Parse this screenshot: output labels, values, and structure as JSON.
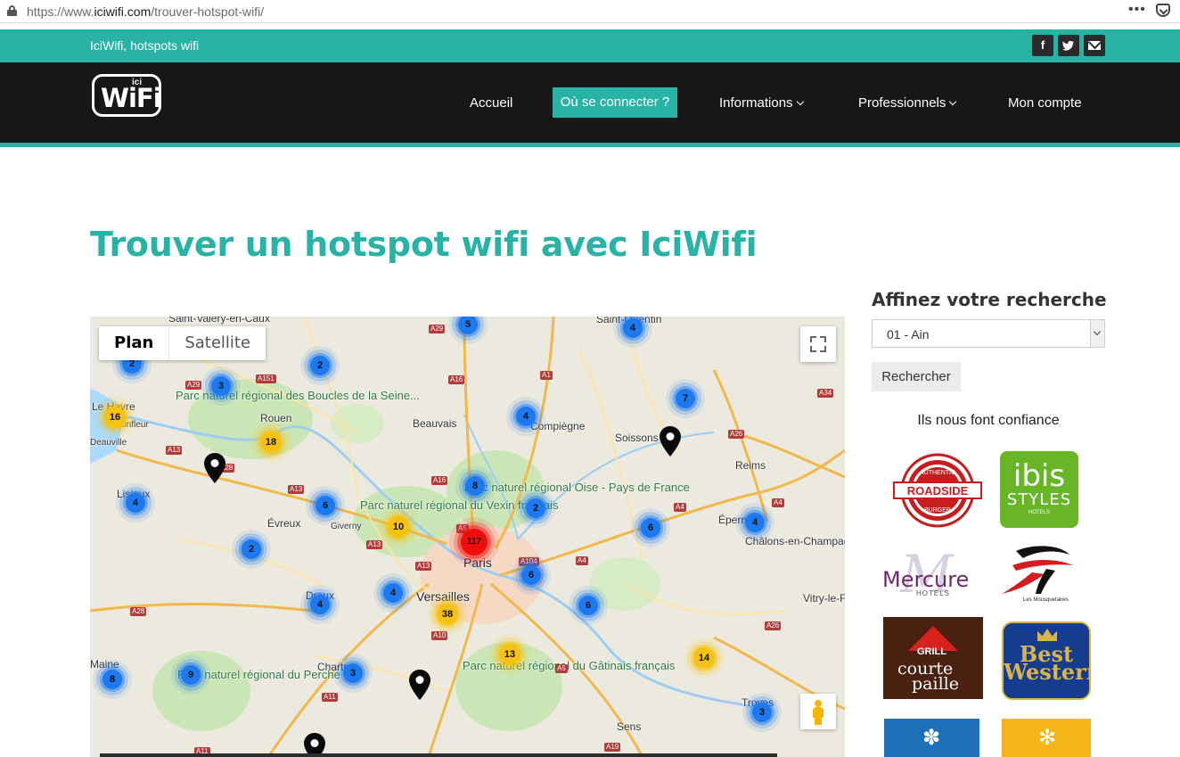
{
  "browser": {
    "url_prefix": "https://www.",
    "url_domain": "iciwifi.com",
    "url_path": "/trouver-hotspot-wifi/",
    "menu_glyph": "•••"
  },
  "topbar": {
    "tagline": "IciWifi, hotspots wifi",
    "social": [
      "f",
      "t",
      "mail"
    ]
  },
  "logo": {
    "text": "WiFi",
    "small": "ici"
  },
  "nav": {
    "home": "Accueil",
    "where": "Où se connecter ?",
    "info": "Informations",
    "pros": "Professionnels",
    "account": "Mon compte"
  },
  "page_title": "Trouver un hotspot wifi avec IciWifi",
  "map": {
    "type_plan": "Plan",
    "type_satellite": "Satellite",
    "clusters": [
      {
        "label": "2",
        "color": "blue"
      },
      {
        "label": "3",
        "color": "blue"
      },
      {
        "label": "16",
        "color": "yellow"
      },
      {
        "label": "2",
        "color": "blue"
      },
      {
        "label": "18",
        "color": "yellow"
      },
      {
        "label": "5",
        "color": "blue"
      },
      {
        "label": "4",
        "color": "blue"
      },
      {
        "label": "4",
        "color": "blue"
      },
      {
        "label": "7",
        "color": "blue"
      },
      {
        "label": "8",
        "color": "blue"
      },
      {
        "label": "2",
        "color": "blue"
      },
      {
        "label": "4",
        "color": "blue"
      },
      {
        "label": "6",
        "color": "blue"
      },
      {
        "label": "10",
        "color": "yellow"
      },
      {
        "label": "117",
        "color": "red"
      },
      {
        "label": "2",
        "color": "blue"
      },
      {
        "label": "6",
        "color": "blue"
      },
      {
        "label": "4",
        "color": "blue"
      },
      {
        "label": "6",
        "color": "blue"
      },
      {
        "label": "4",
        "color": "blue"
      },
      {
        "label": "4",
        "color": "blue"
      },
      {
        "label": "38",
        "color": "yellow"
      },
      {
        "label": "6",
        "color": "blue"
      },
      {
        "label": "13",
        "color": "yellow"
      },
      {
        "label": "14",
        "color": "yellow"
      },
      {
        "label": "9",
        "color": "blue"
      },
      {
        "label": "8",
        "color": "blue"
      },
      {
        "label": "3",
        "color": "blue"
      },
      {
        "label": "3",
        "color": "blue"
      }
    ],
    "places": [
      "Saint-Valery-en-Caux",
      "Saint-Quentin",
      "Le Havre",
      "Honfleur",
      "Deauville",
      "Rouen",
      "Beauvais",
      "Compiègne",
      "Soissons",
      "Reims",
      "Lisieux",
      "Évreux",
      "Giverny",
      "Paris",
      "Versailles",
      "Dreux",
      "Chartres",
      "Sens",
      "Troyes",
      "Épernay",
      "Châlons-en-Champagne",
      "Vitry-le-F",
      "Maine"
    ],
    "parks": [
      "Parc naturel régional des Boucles de la Seine...",
      "Parc naturel régional du Vexin français",
      "Parc naturel régional Oise - Pays de France",
      "Parc naturel régional du Perche",
      "Parc naturel régional du Gâtinais français"
    ],
    "roads": [
      "A29",
      "A151",
      "A16",
      "A1",
      "A34",
      "A29",
      "A13",
      "A26",
      "A28",
      "A13",
      "A16",
      "A4",
      "A4",
      "A13",
      "A13",
      "A104",
      "A4",
      "A5",
      "A10",
      "A28",
      "A11",
      "A26",
      "A19",
      "A11",
      "A5"
    ]
  },
  "sidebar": {
    "title": "Affinez votre recherche",
    "select_value": "01 - Ain",
    "search_button": "Rechercher",
    "trust_title": "Ils nous font confiance",
    "brands": {
      "roadside": {
        "top": "AUTHENTIC",
        "name": "ROADSIDE",
        "bottom": "BURGER"
      },
      "ibis": {
        "name": "ibis",
        "sub": "STYLES",
        "tag": "HOTELS"
      },
      "mercure": {
        "name": "Mercure",
        "sub": "HOTELS"
      },
      "mousquetaires": {
        "name": "Les Mousquetaires"
      },
      "courtepaille": {
        "grill": "GRILL",
        "l1": "courte",
        "l2": "paille"
      },
      "bestwestern": {
        "l1": "Best",
        "l2": "Western"
      }
    }
  },
  "colors": {
    "accent": "#29b3a7",
    "nav_bg": "#171717",
    "cluster_blue": "#1c79f0",
    "cluster_yellow": "#f7c20f",
    "cluster_red": "#f20d0d"
  }
}
